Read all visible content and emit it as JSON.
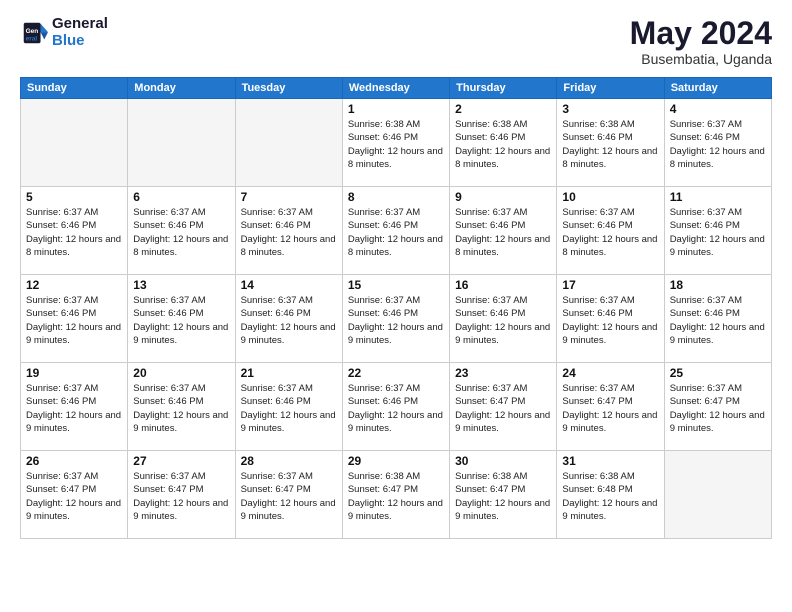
{
  "header": {
    "logo_line1": "General",
    "logo_line2": "Blue",
    "main_title": "May 2024",
    "subtitle": "Busembatia, Uganda"
  },
  "calendar": {
    "days_of_week": [
      "Sunday",
      "Monday",
      "Tuesday",
      "Wednesday",
      "Thursday",
      "Friday",
      "Saturday"
    ],
    "weeks": [
      [
        {
          "day": "",
          "sunrise": "",
          "sunset": "",
          "daylight": "",
          "empty": true
        },
        {
          "day": "",
          "sunrise": "",
          "sunset": "",
          "daylight": "",
          "empty": true
        },
        {
          "day": "",
          "sunrise": "",
          "sunset": "",
          "daylight": "",
          "empty": true
        },
        {
          "day": "1",
          "sunrise": "Sunrise: 6:38 AM",
          "sunset": "Sunset: 6:46 PM",
          "daylight": "Daylight: 12 hours and 8 minutes.",
          "empty": false
        },
        {
          "day": "2",
          "sunrise": "Sunrise: 6:38 AM",
          "sunset": "Sunset: 6:46 PM",
          "daylight": "Daylight: 12 hours and 8 minutes.",
          "empty": false
        },
        {
          "day": "3",
          "sunrise": "Sunrise: 6:38 AM",
          "sunset": "Sunset: 6:46 PM",
          "daylight": "Daylight: 12 hours and 8 minutes.",
          "empty": false
        },
        {
          "day": "4",
          "sunrise": "Sunrise: 6:37 AM",
          "sunset": "Sunset: 6:46 PM",
          "daylight": "Daylight: 12 hours and 8 minutes.",
          "empty": false
        }
      ],
      [
        {
          "day": "5",
          "sunrise": "Sunrise: 6:37 AM",
          "sunset": "Sunset: 6:46 PM",
          "daylight": "Daylight: 12 hours and 8 minutes.",
          "empty": false
        },
        {
          "day": "6",
          "sunrise": "Sunrise: 6:37 AM",
          "sunset": "Sunset: 6:46 PM",
          "daylight": "Daylight: 12 hours and 8 minutes.",
          "empty": false
        },
        {
          "day": "7",
          "sunrise": "Sunrise: 6:37 AM",
          "sunset": "Sunset: 6:46 PM",
          "daylight": "Daylight: 12 hours and 8 minutes.",
          "empty": false
        },
        {
          "day": "8",
          "sunrise": "Sunrise: 6:37 AM",
          "sunset": "Sunset: 6:46 PM",
          "daylight": "Daylight: 12 hours and 8 minutes.",
          "empty": false
        },
        {
          "day": "9",
          "sunrise": "Sunrise: 6:37 AM",
          "sunset": "Sunset: 6:46 PM",
          "daylight": "Daylight: 12 hours and 8 minutes.",
          "empty": false
        },
        {
          "day": "10",
          "sunrise": "Sunrise: 6:37 AM",
          "sunset": "Sunset: 6:46 PM",
          "daylight": "Daylight: 12 hours and 8 minutes.",
          "empty": false
        },
        {
          "day": "11",
          "sunrise": "Sunrise: 6:37 AM",
          "sunset": "Sunset: 6:46 PM",
          "daylight": "Daylight: 12 hours and 9 minutes.",
          "empty": false
        }
      ],
      [
        {
          "day": "12",
          "sunrise": "Sunrise: 6:37 AM",
          "sunset": "Sunset: 6:46 PM",
          "daylight": "Daylight: 12 hours and 9 minutes.",
          "empty": false
        },
        {
          "day": "13",
          "sunrise": "Sunrise: 6:37 AM",
          "sunset": "Sunset: 6:46 PM",
          "daylight": "Daylight: 12 hours and 9 minutes.",
          "empty": false
        },
        {
          "day": "14",
          "sunrise": "Sunrise: 6:37 AM",
          "sunset": "Sunset: 6:46 PM",
          "daylight": "Daylight: 12 hours and 9 minutes.",
          "empty": false
        },
        {
          "day": "15",
          "sunrise": "Sunrise: 6:37 AM",
          "sunset": "Sunset: 6:46 PM",
          "daylight": "Daylight: 12 hours and 9 minutes.",
          "empty": false
        },
        {
          "day": "16",
          "sunrise": "Sunrise: 6:37 AM",
          "sunset": "Sunset: 6:46 PM",
          "daylight": "Daylight: 12 hours and 9 minutes.",
          "empty": false
        },
        {
          "day": "17",
          "sunrise": "Sunrise: 6:37 AM",
          "sunset": "Sunset: 6:46 PM",
          "daylight": "Daylight: 12 hours and 9 minutes.",
          "empty": false
        },
        {
          "day": "18",
          "sunrise": "Sunrise: 6:37 AM",
          "sunset": "Sunset: 6:46 PM",
          "daylight": "Daylight: 12 hours and 9 minutes.",
          "empty": false
        }
      ],
      [
        {
          "day": "19",
          "sunrise": "Sunrise: 6:37 AM",
          "sunset": "Sunset: 6:46 PM",
          "daylight": "Daylight: 12 hours and 9 minutes.",
          "empty": false
        },
        {
          "day": "20",
          "sunrise": "Sunrise: 6:37 AM",
          "sunset": "Sunset: 6:46 PM",
          "daylight": "Daylight: 12 hours and 9 minutes.",
          "empty": false
        },
        {
          "day": "21",
          "sunrise": "Sunrise: 6:37 AM",
          "sunset": "Sunset: 6:46 PM",
          "daylight": "Daylight: 12 hours and 9 minutes.",
          "empty": false
        },
        {
          "day": "22",
          "sunrise": "Sunrise: 6:37 AM",
          "sunset": "Sunset: 6:46 PM",
          "daylight": "Daylight: 12 hours and 9 minutes.",
          "empty": false
        },
        {
          "day": "23",
          "sunrise": "Sunrise: 6:37 AM",
          "sunset": "Sunset: 6:47 PM",
          "daylight": "Daylight: 12 hours and 9 minutes.",
          "empty": false
        },
        {
          "day": "24",
          "sunrise": "Sunrise: 6:37 AM",
          "sunset": "Sunset: 6:47 PM",
          "daylight": "Daylight: 12 hours and 9 minutes.",
          "empty": false
        },
        {
          "day": "25",
          "sunrise": "Sunrise: 6:37 AM",
          "sunset": "Sunset: 6:47 PM",
          "daylight": "Daylight: 12 hours and 9 minutes.",
          "empty": false
        }
      ],
      [
        {
          "day": "26",
          "sunrise": "Sunrise: 6:37 AM",
          "sunset": "Sunset: 6:47 PM",
          "daylight": "Daylight: 12 hours and 9 minutes.",
          "empty": false
        },
        {
          "day": "27",
          "sunrise": "Sunrise: 6:37 AM",
          "sunset": "Sunset: 6:47 PM",
          "daylight": "Daylight: 12 hours and 9 minutes.",
          "empty": false
        },
        {
          "day": "28",
          "sunrise": "Sunrise: 6:37 AM",
          "sunset": "Sunset: 6:47 PM",
          "daylight": "Daylight: 12 hours and 9 minutes.",
          "empty": false
        },
        {
          "day": "29",
          "sunrise": "Sunrise: 6:38 AM",
          "sunset": "Sunset: 6:47 PM",
          "daylight": "Daylight: 12 hours and 9 minutes.",
          "empty": false
        },
        {
          "day": "30",
          "sunrise": "Sunrise: 6:38 AM",
          "sunset": "Sunset: 6:47 PM",
          "daylight": "Daylight: 12 hours and 9 minutes.",
          "empty": false
        },
        {
          "day": "31",
          "sunrise": "Sunrise: 6:38 AM",
          "sunset": "Sunset: 6:48 PM",
          "daylight": "Daylight: 12 hours and 9 minutes.",
          "empty": false
        },
        {
          "day": "",
          "sunrise": "",
          "sunset": "",
          "daylight": "",
          "empty": true
        }
      ]
    ]
  }
}
